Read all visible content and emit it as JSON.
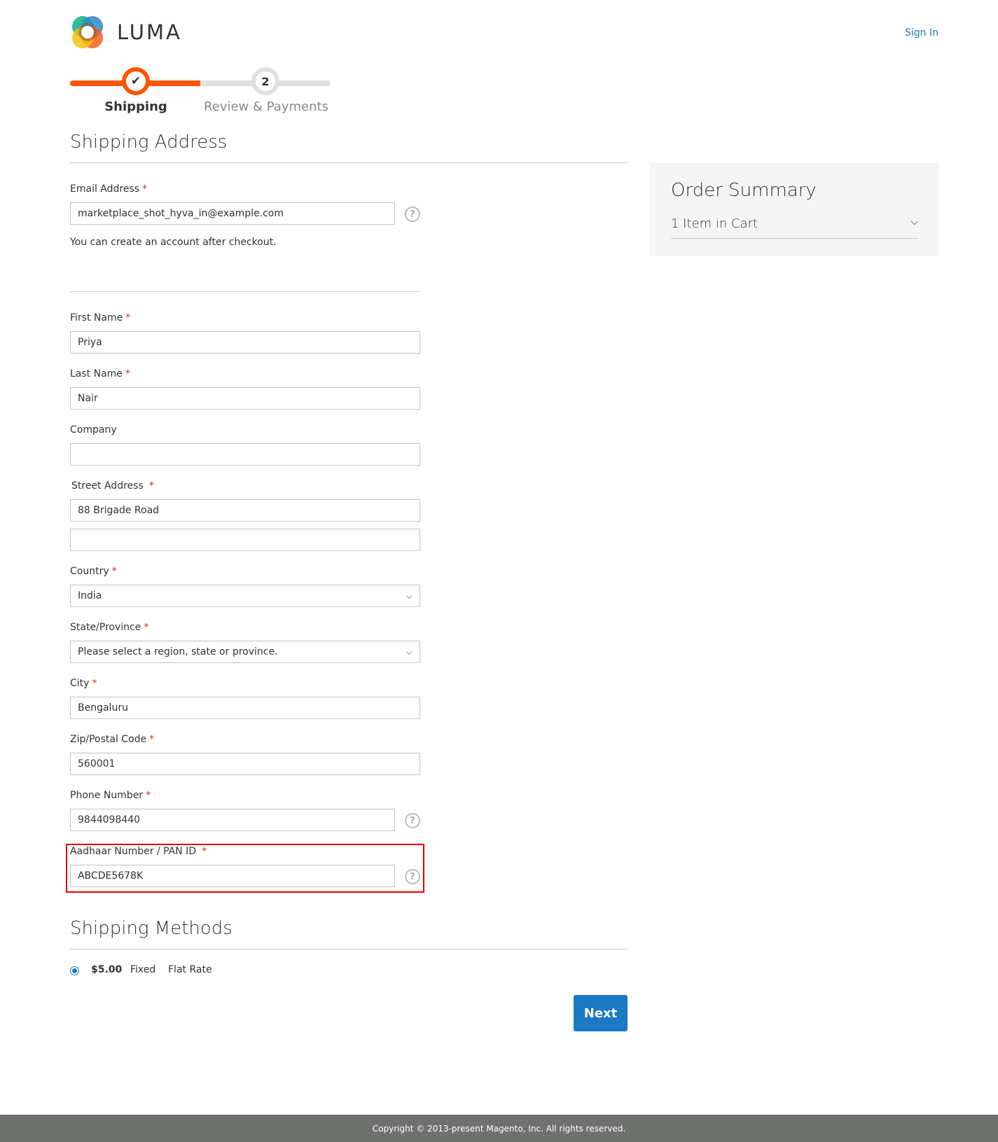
{
  "header": {
    "logo_text": "LUMA",
    "sign_in": "Sign In"
  },
  "progress": {
    "steps": [
      {
        "label": "Shipping",
        "marker": "✔",
        "state": "complete"
      },
      {
        "label": "Review & Payments",
        "marker": "2",
        "state": "pending"
      }
    ],
    "accent_color": "#ff5501"
  },
  "shipping_address": {
    "title": "Shipping Address",
    "email": {
      "label": "Email Address",
      "value": "marketplace_shot_hyva_in@example.com",
      "note": "You can create an account after checkout."
    },
    "first_name": {
      "label": "First Name",
      "value": "Priya"
    },
    "last_name": {
      "label": "Last Name",
      "value": "Nair"
    },
    "company": {
      "label": "Company",
      "value": ""
    },
    "street": {
      "label": "Street Address",
      "line1": "88 Brigade Road",
      "line2": ""
    },
    "country": {
      "label": "Country",
      "value": "India"
    },
    "state": {
      "label": "State/Province",
      "value": "Please select a region, state or province."
    },
    "city": {
      "label": "City",
      "value": "Bengaluru"
    },
    "zip": {
      "label": "Zip/Postal Code",
      "value": "560001"
    },
    "phone": {
      "label": "Phone Number",
      "value": "9844098440"
    },
    "aadhaar": {
      "label": "Aadhaar Number / PAN ID",
      "value": "ABCDE5678K"
    },
    "required_mark": "*",
    "help_glyph": "?"
  },
  "shipping_methods": {
    "title": "Shipping Methods",
    "rows": [
      {
        "price": "$5.00",
        "method": "Fixed",
        "carrier": "Flat Rate",
        "selected": true
      }
    ],
    "next_label": "Next"
  },
  "order_summary": {
    "title": "Order Summary",
    "items": "1 Item in Cart"
  },
  "footer": {
    "copyright": "Copyright © 2013-present Magento, Inc. All rights reserved."
  },
  "colors": {
    "link": "#1979c3",
    "required": "#e02b27",
    "button": "#1979c3",
    "highlight_box": "#e00000"
  }
}
